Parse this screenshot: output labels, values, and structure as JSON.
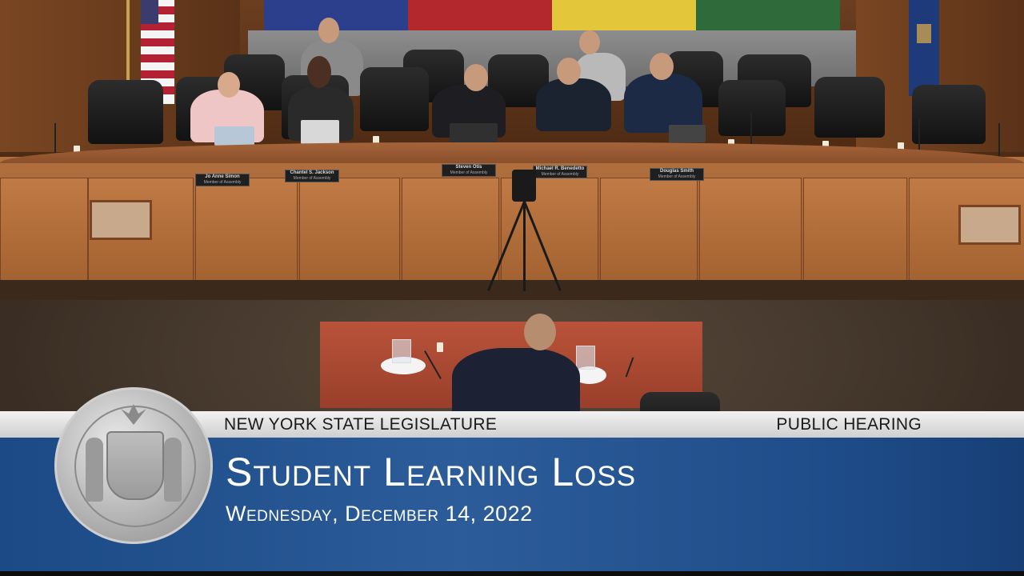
{
  "banner": {
    "organization": "NEW YORK STATE LEGISLATURE",
    "event_type": "PUBLIC HEARING",
    "title": "Student Learning Loss",
    "date": "Wednesday, December 14, 2022"
  },
  "nameplates": [
    {
      "name": "Jo Anne Simon",
      "role": "Member of Assembly"
    },
    {
      "name": "Chantel S. Jackson",
      "role": "Member of Assembly"
    },
    {
      "name": "Steven Otis",
      "role": "Member of Assembly"
    },
    {
      "name": "Michael R. Benedetto",
      "role": "Member of Assembly"
    },
    {
      "name": "Douglas Smith",
      "role": "Member of Assembly"
    }
  ],
  "colors": {
    "banner_blue": "#2c5c99",
    "banner_silver": "#e0e0e0",
    "dais_wood": "#a5643a",
    "witness_table": "#b9533a"
  },
  "icons": {
    "seal": "new-york-state-seal-icon"
  }
}
